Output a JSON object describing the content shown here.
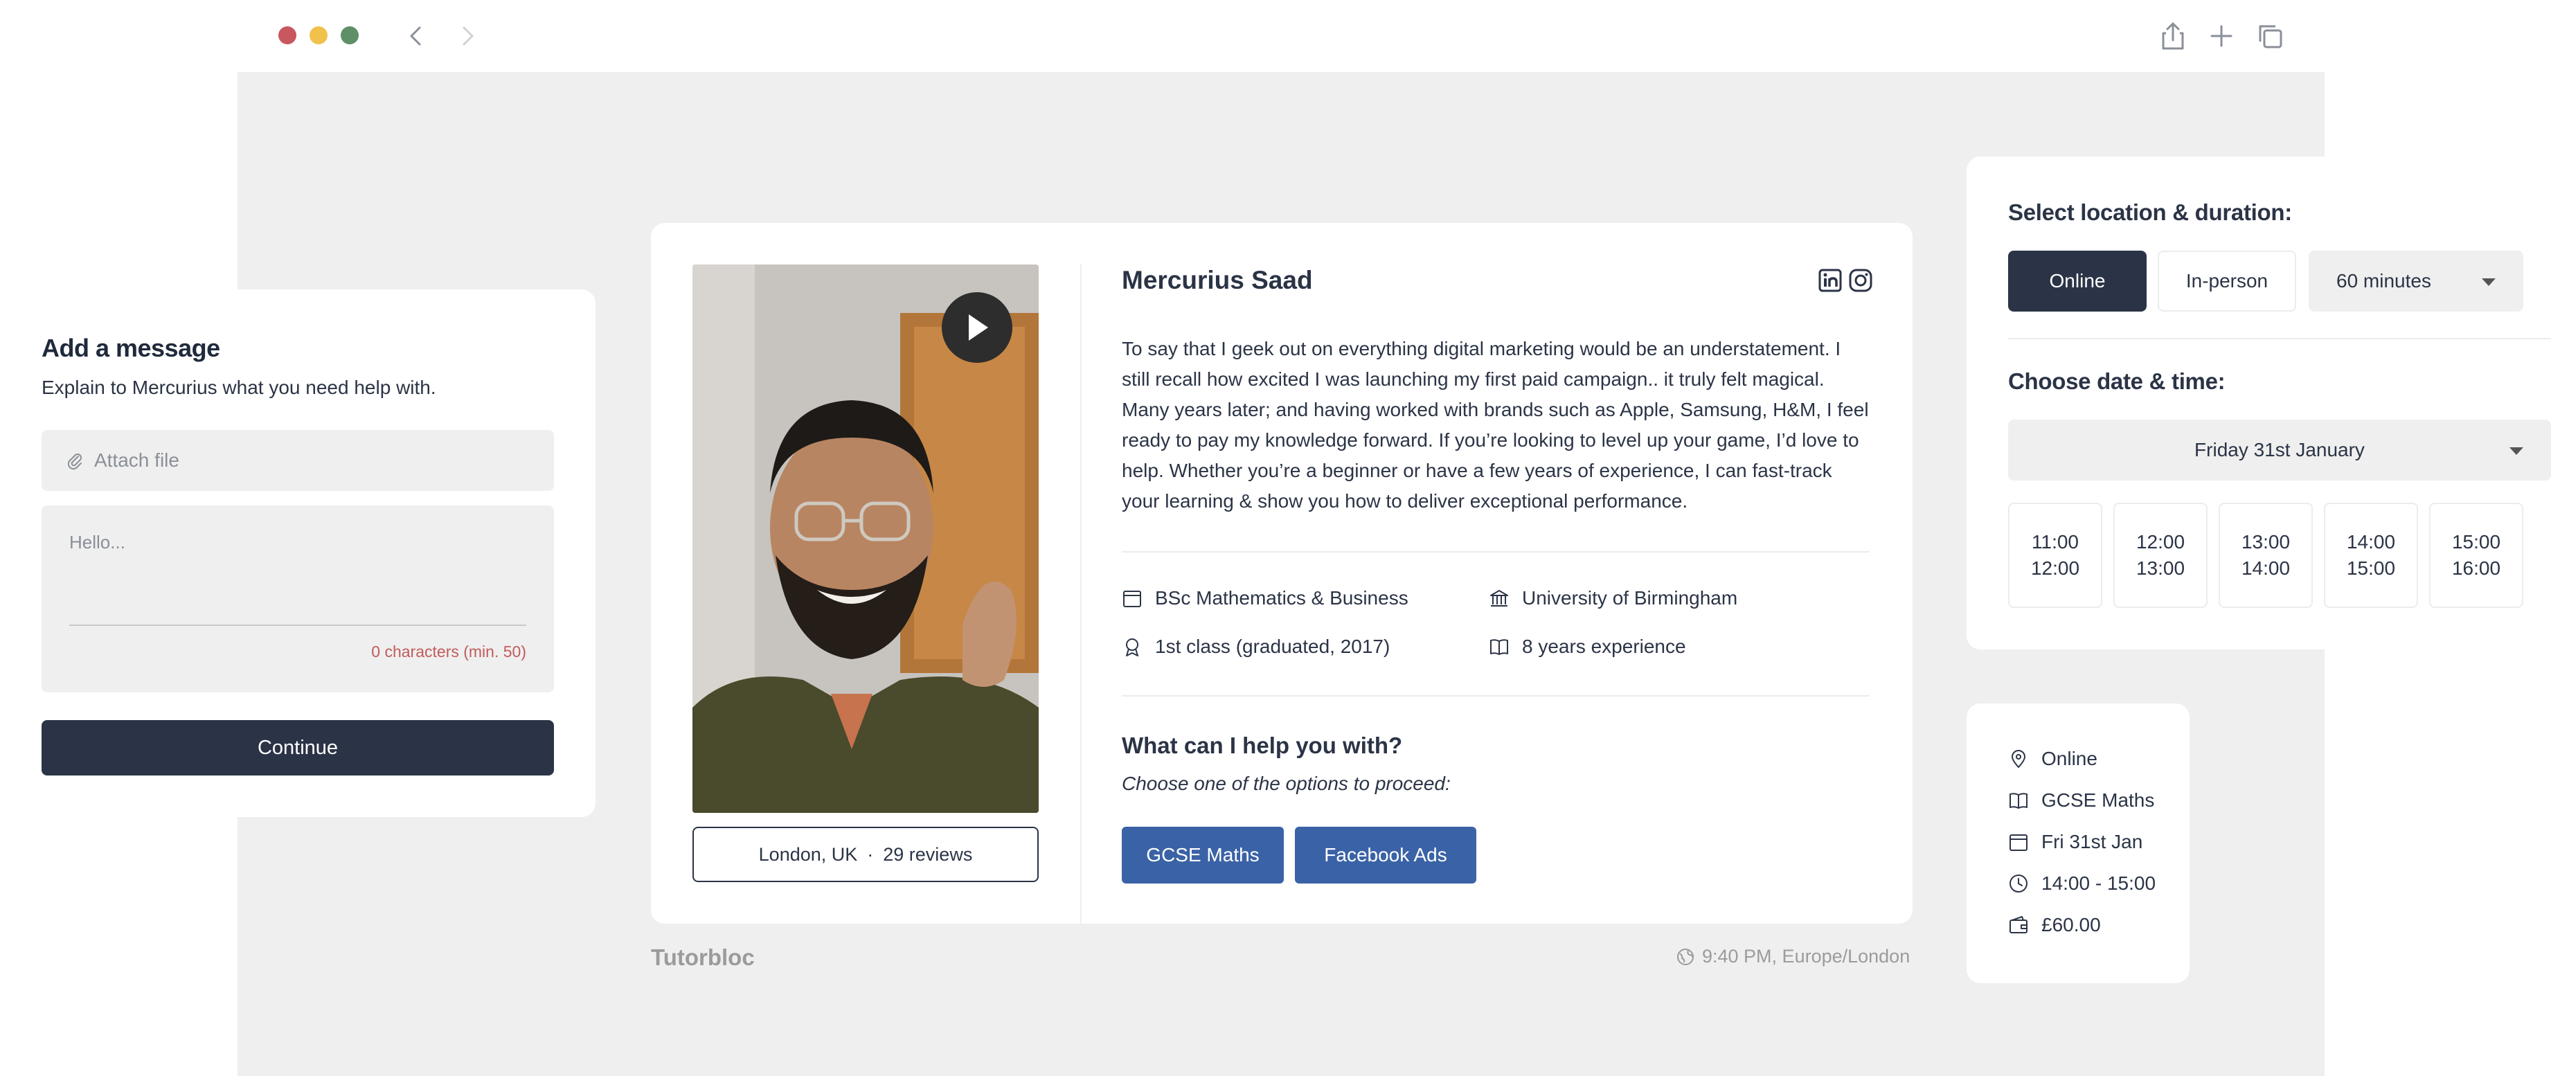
{
  "window": {
    "nav_back_icon": "chevron-left-icon",
    "nav_forward_icon": "chevron-right-icon",
    "actions": [
      "share-icon",
      "plus-icon",
      "duplicate-icon"
    ]
  },
  "message": {
    "title": "Add a message",
    "subtitle": "Explain to Mercurius what you need help with.",
    "attach_label": "Attach file",
    "textarea_placeholder": "Hello...",
    "textarea_value": "",
    "char_count": "0 characters (min. 50)",
    "continue_label": "Continue"
  },
  "profile": {
    "name": "Mercurius Saad",
    "bio": "To say that I geek out on everything digital marketing would be an understatement. I still recall how excited I was launching my first paid campaign.. it truly felt magical. Many years later; and having worked with brands such as Apple, Samsung, H&M, I feel ready to pay my knowledge forward. If you’re looking to level up your game, I’d love to help. Whether you’re a beginner or have a few years of experience, I can fast-track your learning & show you how to deliver exceptional performance.",
    "location": "London, UK",
    "separator": "·",
    "reviews": "29 reviews",
    "facts": {
      "degree": "BSc Mathematics & Business",
      "university": "University of Birmingham",
      "grade": "1st class (graduated, 2017)",
      "experience": "8 years experience"
    },
    "help_title": "What can I help you with?",
    "help_subtitle": "Choose one of the options to proceed:",
    "options": [
      "GCSE Maths",
      "Facebook Ads"
    ]
  },
  "footer": {
    "brand": "Tutorbloc",
    "time": "9:40 PM, Europe/London"
  },
  "booking": {
    "location_title": "Select location & duration:",
    "location_options": [
      "Online",
      "In-person"
    ],
    "selected_location": "Online",
    "duration": "60 minutes",
    "date_title": "Choose date & time:",
    "date": "Friday 31st January",
    "slots": [
      {
        "start": "11:00",
        "end": "12:00"
      },
      {
        "start": "12:00",
        "end": "13:00"
      },
      {
        "start": "13:00",
        "end": "14:00"
      },
      {
        "start": "14:00",
        "end": "15:00"
      },
      {
        "start": "15:00",
        "end": "16:00"
      }
    ]
  },
  "summary": {
    "location": "Online",
    "subject": "GCSE Maths",
    "date": "Fri 31st Jan",
    "time": "14:00 - 15:00",
    "price": "£60.00"
  },
  "colors": {
    "primary_dark": "#2b3446",
    "option_blue": "#3a62a6",
    "error_red": "#c25b5b",
    "canvas_grey": "#efefef"
  }
}
